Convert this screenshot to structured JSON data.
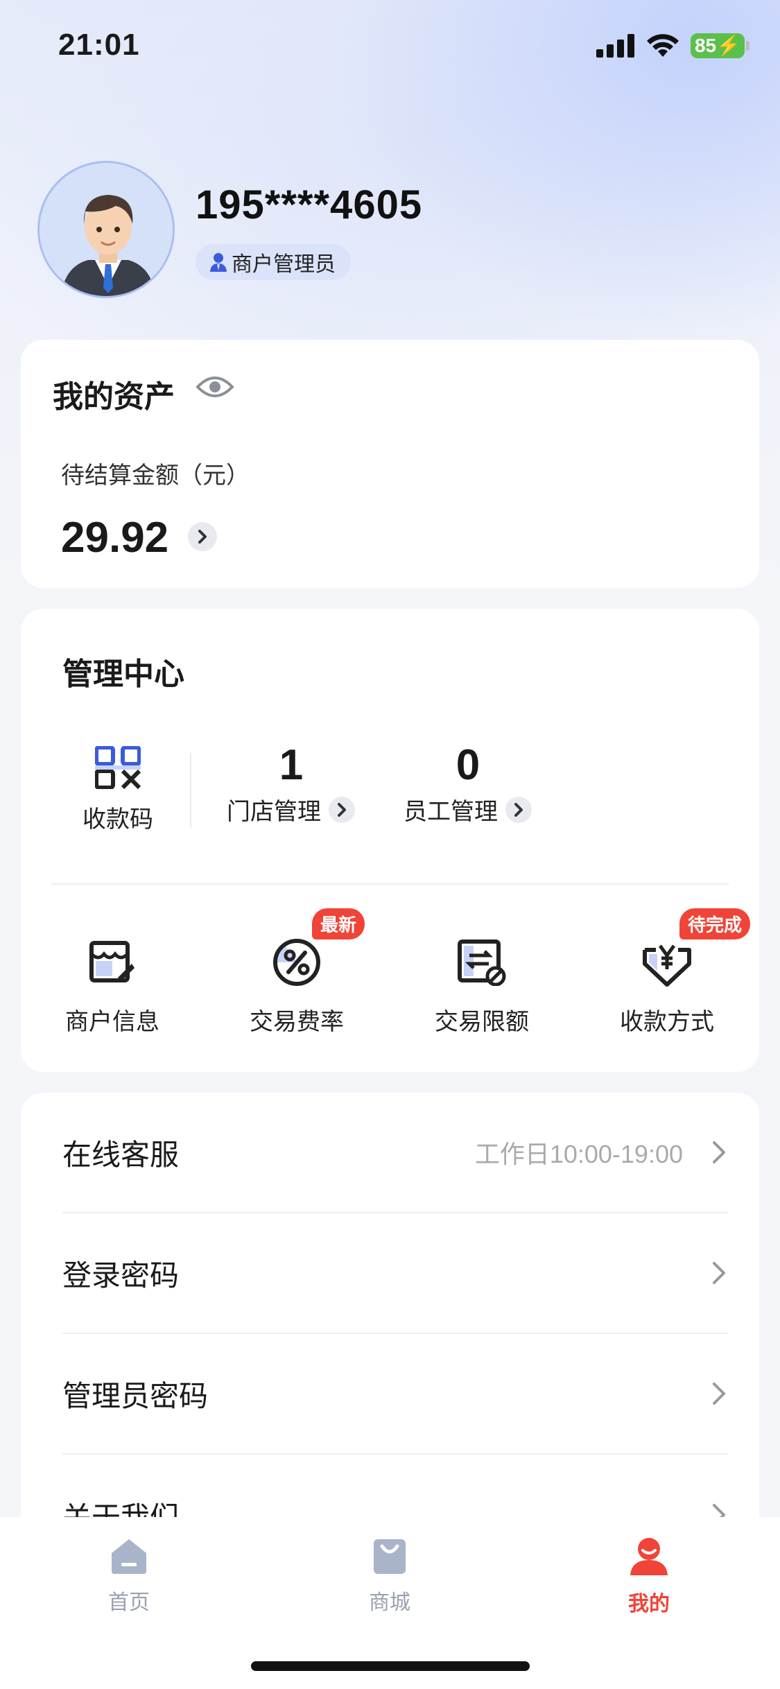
{
  "status_bar": {
    "time": "21:01",
    "battery": "85"
  },
  "profile": {
    "phone": "195****4605",
    "role": "商户管理员"
  },
  "assets": {
    "title": "我的资产",
    "pending_label": "待结算金额（元）",
    "pending_amount": "29.92"
  },
  "management": {
    "title": "管理中心",
    "qr_label": "收款码",
    "stats": [
      {
        "value": "1",
        "label": "门店管理"
      },
      {
        "value": "0",
        "label": "员工管理"
      }
    ],
    "tools": [
      {
        "label": "商户信息",
        "icon": "shop-info-icon",
        "tag": ""
      },
      {
        "label": "交易费率",
        "icon": "percent-icon",
        "tag": "最新"
      },
      {
        "label": "交易限额",
        "icon": "limit-icon",
        "tag": ""
      },
      {
        "label": "收款方式",
        "icon": "yuan-shield-icon",
        "tag": "待完成"
      }
    ]
  },
  "settings": [
    {
      "label": "在线客服",
      "hint": "工作日10:00-19:00"
    },
    {
      "label": "登录密码",
      "hint": ""
    },
    {
      "label": "管理员密码",
      "hint": ""
    },
    {
      "label": "关于我们",
      "hint": ""
    }
  ],
  "tabs": [
    {
      "label": "首页",
      "icon": "home-icon",
      "active": false
    },
    {
      "label": "商城",
      "icon": "shopping-bag-icon",
      "active": false
    },
    {
      "label": "我的",
      "icon": "profile-icon",
      "active": true
    }
  ],
  "colors": {
    "accent": "#f04438",
    "icon_blue": "#3b5bdb",
    "battery": "#5ac04b"
  }
}
